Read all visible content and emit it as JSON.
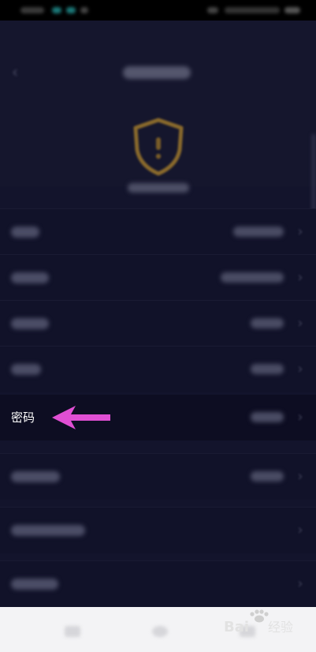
{
  "status_bar": {},
  "header": {},
  "list": {
    "rows": [
      {
        "id": "row-1"
      },
      {
        "id": "row-2"
      },
      {
        "id": "row-3"
      },
      {
        "id": "row-4"
      },
      {
        "id": "row-password",
        "label": "密码"
      },
      {
        "id": "row-6"
      },
      {
        "id": "row-7"
      },
      {
        "id": "row-8"
      }
    ]
  },
  "watermark": {
    "brand_text": "Bai",
    "suffix_text": "经验"
  },
  "colors": {
    "background": "#13142c",
    "arrow": "#e04fd4",
    "shield": "#8a6a2c",
    "navbar": "#f3f3f5"
  },
  "icons": [
    "back-arrow-icon",
    "shield-icon",
    "chevron-right-icon",
    "pointer-arrow-icon",
    "baidu-paw-icon"
  ]
}
